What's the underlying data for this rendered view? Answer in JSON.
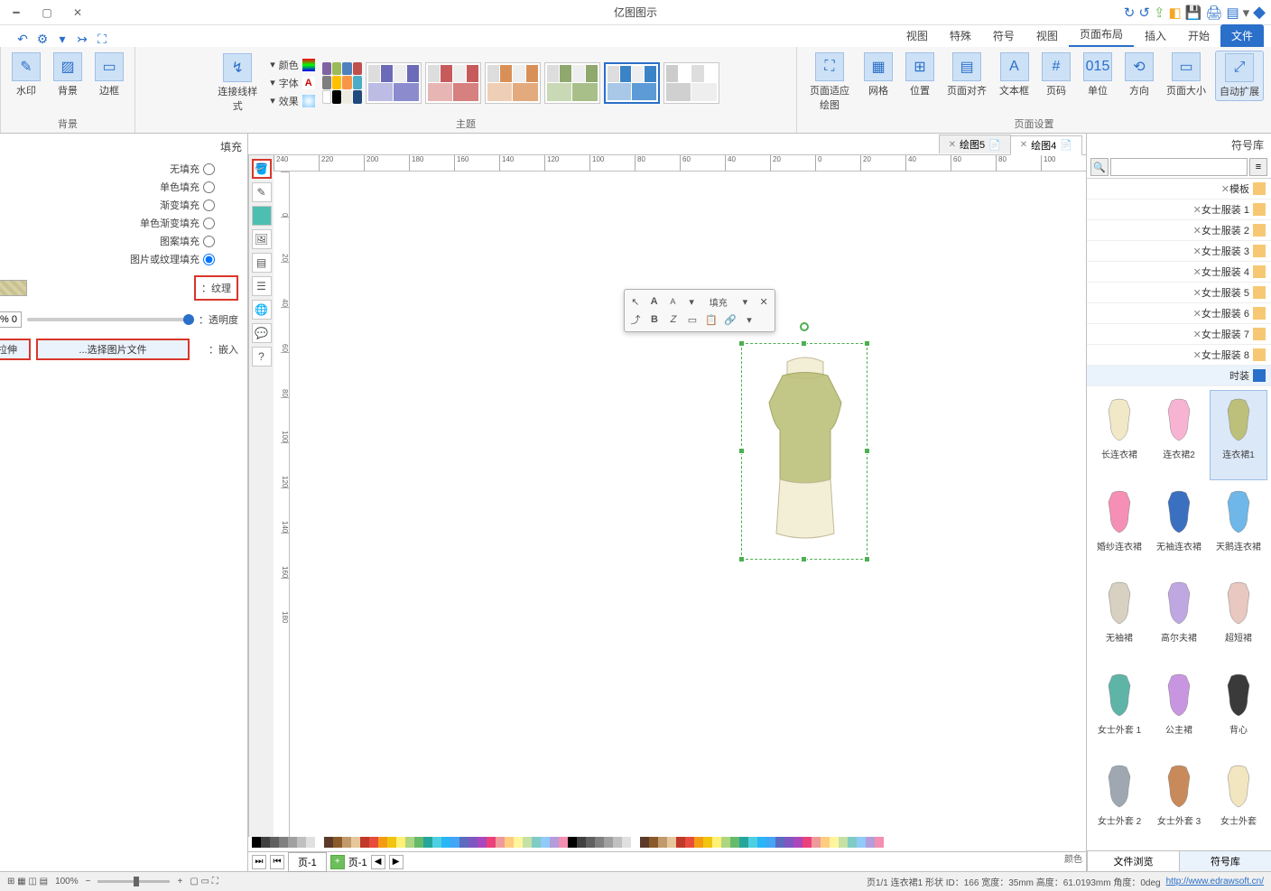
{
  "window": {
    "title": "亿图图示"
  },
  "qat_icons": [
    "new",
    "open",
    "save",
    "print",
    "export",
    "undo",
    "redo"
  ],
  "menu_tabs": [
    "文件",
    "开始",
    "插入",
    "页面布局",
    "视图",
    "符号",
    "特殊",
    "视图"
  ],
  "menu_active": "页面布局",
  "ribbon": {
    "group_page": "页面设置",
    "btns_page": [
      "自动扩展",
      "页面大小",
      "方向",
      "单位",
      "页码",
      "文本框",
      "页面对齐",
      "位置",
      "网格",
      "页面适应绘图"
    ],
    "group_theme": "主题",
    "theme_more": "⋯",
    "color_btn": "颜色",
    "font_btn": "字体",
    "effect_btn": "效果",
    "shape_btn": "连接线样式",
    "group_bg": "背景",
    "btns_bg": [
      "边框",
      "背景",
      "水印"
    ]
  },
  "symbol_panel": {
    "title": "符号库",
    "search_placeholder": "",
    "categories": [
      "模板",
      "女士服装 1",
      "女士服装 2",
      "女士服装 3",
      "女士服装 4",
      "女士服装 5",
      "女士服装 6",
      "女士服装 7",
      "女士服装 8",
      "时装"
    ],
    "shapes": [
      {
        "label": "连衣裙1",
        "selected": true
      },
      {
        "label": "连衣裙2"
      },
      {
        "label": "长连衣裙"
      },
      {
        "label": "天鹅连衣裙"
      },
      {
        "label": "无袖连衣裙"
      },
      {
        "label": "婚纱连衣裙"
      },
      {
        "label": "超短裙"
      },
      {
        "label": "高尔夫裙"
      },
      {
        "label": "无袖裙"
      },
      {
        "label": "背心"
      },
      {
        "label": "公主裙"
      },
      {
        "label": "女士外套 1"
      },
      {
        "label": "女士外套"
      },
      {
        "label": "女士外套 3"
      },
      {
        "label": "女士外套 2"
      }
    ],
    "tabs": [
      "符号库",
      "文件浏览"
    ]
  },
  "doc_tabs": [
    {
      "label": "绘图4",
      "active": true
    },
    {
      "label": "绘图5",
      "active": false
    }
  ],
  "page_tabs": {
    "label": "页-1",
    "current": "页-1"
  },
  "float_toolbar": {
    "row1": [
      "↖",
      "A",
      "A",
      "▾",
      "填充",
      "▾",
      "✕"
    ],
    "row2": [
      "⤴",
      "B",
      "Z",
      "▭",
      "📋",
      "🔗",
      "▾"
    ]
  },
  "fill_panel": {
    "title": "填充",
    "radios": [
      "无填充",
      "单色填充",
      "渐变填充",
      "单色渐变填充",
      "图案填充",
      "图片或纹理填充"
    ],
    "selected_radio": 5,
    "texture_label": "纹理：",
    "opacity_label": "透明度：",
    "opacity_value": "0 %",
    "embed_label": "嵌入：",
    "choose_btn": "选择图片文件...",
    "toggle_btn": "拉伸"
  },
  "canvas_tools": [
    "cursor",
    "pen",
    "rect",
    "image",
    "text",
    "layer",
    "globe",
    "comment",
    "help"
  ],
  "ruler_marks_h": [
    "240",
    "220",
    "200",
    "180",
    "160",
    "140",
    "120",
    "100",
    "80",
    "60",
    "40",
    "20",
    "0",
    "20",
    "40",
    "60",
    "80",
    "100"
  ],
  "ruler_marks_v": [
    "0",
    "20",
    "40",
    "60",
    "80",
    "100",
    "120",
    "140",
    "160",
    "180"
  ],
  "statusbar": {
    "link": "http://www.edrawsoft.cn/",
    "info": "页1/1  连衣裙1  形状 ID：166  宽度：35mm  高度：61.0193mm  角度：0deg",
    "zoom": "100%",
    "color_label": "颜色"
  },
  "colors": [
    "#000000",
    "#404040",
    "#606060",
    "#808080",
    "#a0a0a0",
    "#c0c0c0",
    "#e0e0e0",
    "#ffffff",
    "#5b3a29",
    "#8b5a2b",
    "#c19a6b",
    "#e6c79c",
    "#c0392b",
    "#e74c3c",
    "#f39c12",
    "#f1c40f",
    "#fff176",
    "#aed581",
    "#66bb6a",
    "#26a69a",
    "#4dd0e1",
    "#29b6f6",
    "#42a5f5",
    "#5c6bc0",
    "#7e57c2",
    "#ab47bc",
    "#ec407a",
    "#ef9a9a",
    "#ffcc80",
    "#fff59d",
    "#c5e1a5",
    "#80cbc4",
    "#90caf9",
    "#b39ddb",
    "#f48fb1"
  ]
}
